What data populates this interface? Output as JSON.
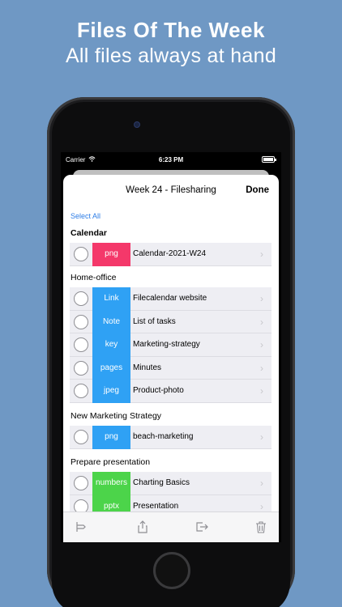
{
  "promo": {
    "title": "Files Of The Week",
    "subtitle": "All files always at hand"
  },
  "statusbar": {
    "carrier": "Carrier",
    "time": "6:23 PM"
  },
  "nav": {
    "title": "Week 24 - Filesharing",
    "done_label": "Done"
  },
  "select_all_label": "Select All",
  "sections": [
    {
      "header": "Calendar",
      "items": [
        {
          "type": "png",
          "type_color": "#f4386a",
          "name": "Calendar-2021-W24"
        }
      ]
    },
    {
      "header": "Home-office",
      "items": [
        {
          "type": "Link",
          "type_color": "#2fa1f4",
          "name": "Filecalendar website"
        },
        {
          "type": "Note",
          "type_color": "#2fa1f4",
          "name": "List of tasks"
        },
        {
          "type": "key",
          "type_color": "#2fa1f4",
          "name": "Marketing-strategy"
        },
        {
          "type": "pages",
          "type_color": "#2fa1f4",
          "name": "Minutes"
        },
        {
          "type": "jpeg",
          "type_color": "#2fa1f4",
          "name": "Product-photo"
        }
      ]
    },
    {
      "header": "New Marketing Strategy",
      "items": [
        {
          "type": "png",
          "type_color": "#2fa1f4",
          "name": "beach-marketing"
        }
      ]
    },
    {
      "header": "Prepare presentation",
      "items": [
        {
          "type": "numbers",
          "type_color": "#4cd44a",
          "name": "Charting Basics"
        },
        {
          "type": "pptx",
          "type_color": "#4cd44a",
          "name": "Presentation"
        }
      ]
    }
  ],
  "toolbar": {
    "icons": [
      "tag-icon",
      "share-icon",
      "move-out-icon",
      "trash-icon"
    ]
  }
}
